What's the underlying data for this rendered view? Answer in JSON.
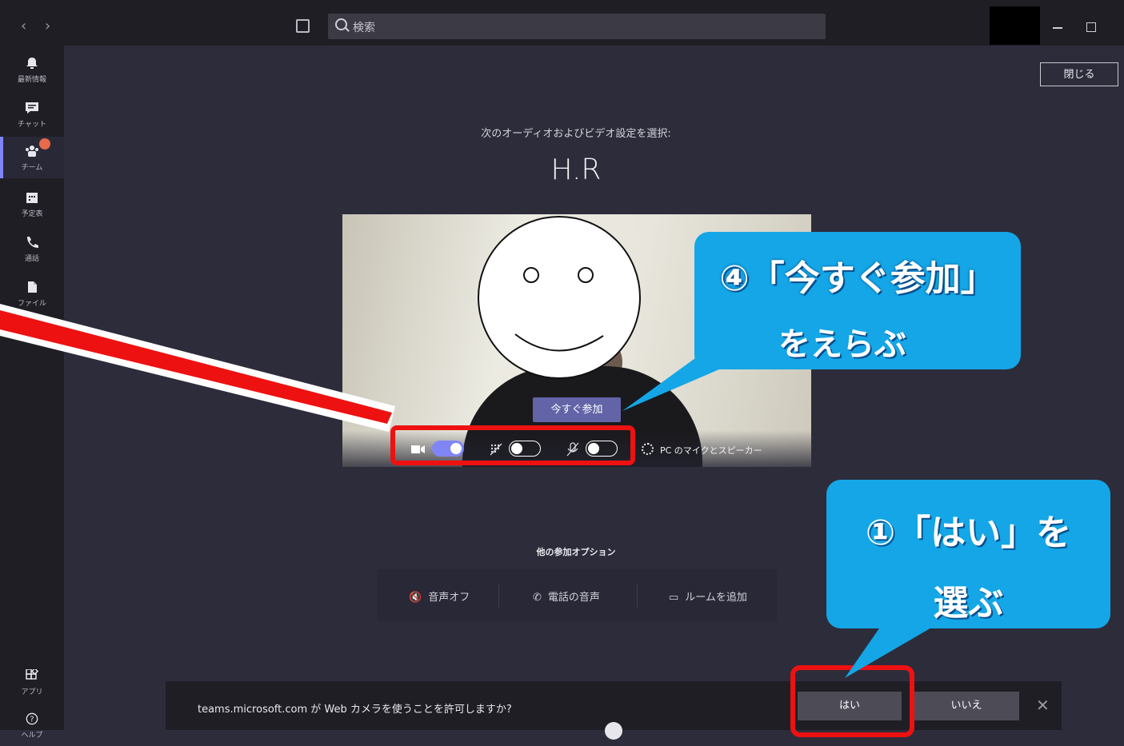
{
  "titlebar": {
    "back_icon": "‹",
    "forward_icon": "›",
    "search_placeholder": "検索"
  },
  "rail": {
    "items": [
      {
        "label": "最新情報",
        "icon": "bell-icon"
      },
      {
        "label": "チャット",
        "icon": "chat-icon"
      },
      {
        "label": "チーム",
        "icon": "teams-icon",
        "active": true
      },
      {
        "label": "予定表",
        "icon": "calendar-icon"
      },
      {
        "label": "通話",
        "icon": "phone-icon"
      },
      {
        "label": "ファイル",
        "icon": "file-icon"
      }
    ],
    "more": "...",
    "bottom_items": [
      {
        "label": "アプリ",
        "icon": "apps-icon"
      },
      {
        "label": "ヘルプ",
        "icon": "help-icon"
      }
    ]
  },
  "main": {
    "close_label": "閉じる",
    "prompt": "次のオーディオおよびビデオ設定を選択:",
    "user_name": "H.R",
    "join_label": "今すぐ参加",
    "camera_on": true,
    "blur_on": false,
    "mic_on": false,
    "device_label": "PC のマイクとスピーカー",
    "other_options_title": "他の参加オプション",
    "options": [
      {
        "label": "音声オフ",
        "icon": "speaker-off-icon"
      },
      {
        "label": "電話の音声",
        "icon": "phone-icon"
      },
      {
        "label": "ルームを追加",
        "icon": "room-icon"
      }
    ]
  },
  "permission": {
    "text": "teams.microsoft.com が Web カメラを使うことを許可しますか?",
    "yes": "はい",
    "no": "いいえ",
    "close": "✕"
  },
  "annotations": {
    "callout4_line1": "④「今すぐ参加」",
    "callout4_line2": "をえらぶ",
    "callout1_line1": "①「はい」を",
    "callout1_line2": "選ぶ",
    "accent": "#ee1111",
    "callout_color": "#14a6e6"
  }
}
